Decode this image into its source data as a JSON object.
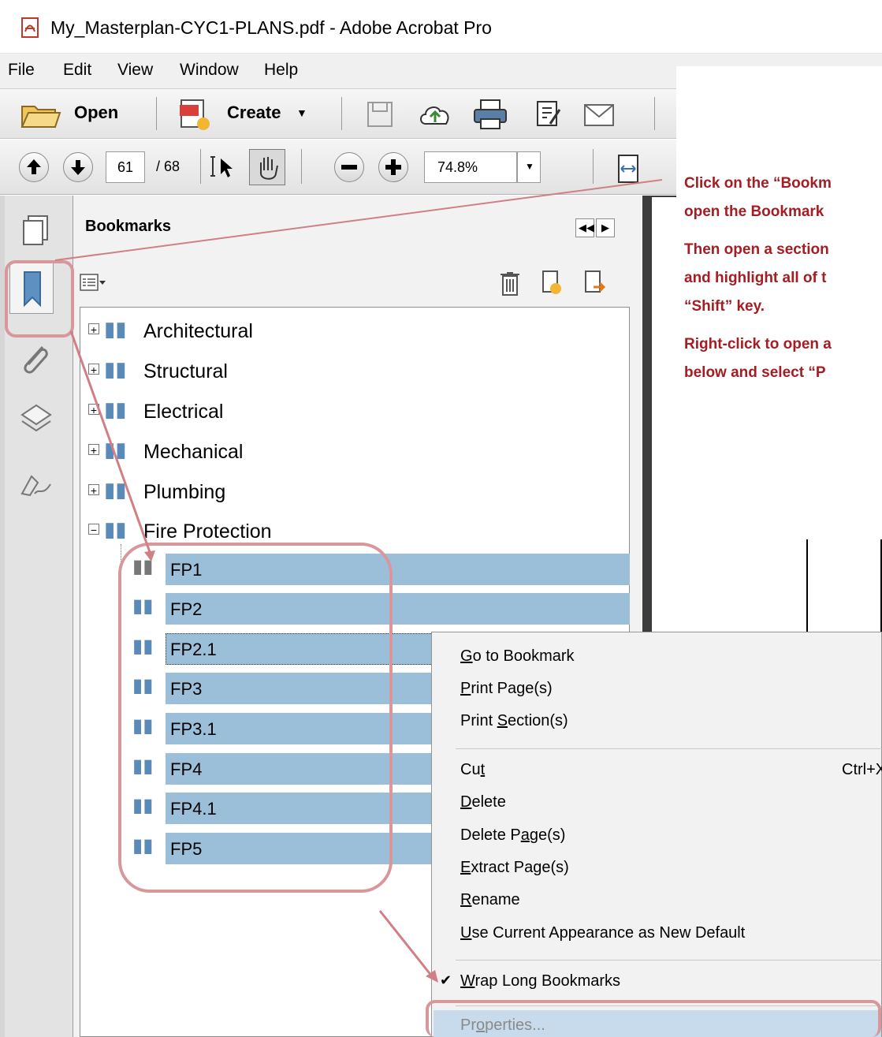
{
  "window": {
    "title": "My_Masterplan-CYC1-PLANS.pdf - Adobe Acrobat Pro"
  },
  "menubar": {
    "items": [
      "File",
      "Edit",
      "View",
      "Window",
      "Help"
    ]
  },
  "toolbar": {
    "open_label": "Open",
    "create_label": "Create",
    "page_current": "61",
    "page_total": "/ 68",
    "zoom_value": "74.8%"
  },
  "panel": {
    "title": "Bookmarks",
    "top_level": [
      "Architectural",
      "Structural",
      "Electrical",
      "Mechanical",
      "Plumbing",
      "Fire Protection"
    ],
    "fire_protection_children": [
      "FP1",
      "FP2",
      "FP2.1",
      "FP3",
      "FP3.1",
      "FP4",
      "FP4.1",
      "FP5"
    ]
  },
  "callout": {
    "lines": [
      "Click on the “Bookm",
      "open the Bookmark",
      "Then open a section",
      "and highlight all of t",
      "“Shift” key.",
      "Right-click to open a",
      "below and select “P"
    ],
    "color": "#a31d23"
  },
  "context_menu": {
    "items": [
      {
        "label": "Go to Bookmark",
        "mnemonic": "G"
      },
      {
        "label": "Print Page(s)",
        "mnemonic": "P"
      },
      {
        "label": "Print Section(s)",
        "mnemonic": "S"
      },
      {
        "label": "Cut",
        "mnemonic": "t",
        "shortcut": "Ctrl+X"
      },
      {
        "label": "Delete",
        "mnemonic": "D"
      },
      {
        "label": "Delete Page(s)",
        "mnemonic": "a"
      },
      {
        "label": "Extract Page(s)",
        "mnemonic": "E"
      },
      {
        "label": "Rename",
        "mnemonic": "R"
      },
      {
        "label": "Use Current Appearance as New Default",
        "mnemonic": "U"
      },
      {
        "label": "Wrap Long Bookmarks",
        "mnemonic": "W",
        "checked": true
      },
      {
        "label": "Properties...",
        "mnemonic": "o",
        "highlighted": true
      }
    ],
    "cut_shortcut": "Ctrl+X"
  },
  "colors": {
    "selection": "#9bbfd9",
    "highlight_outline": "#d7979b",
    "arrow": "#d07f85"
  }
}
